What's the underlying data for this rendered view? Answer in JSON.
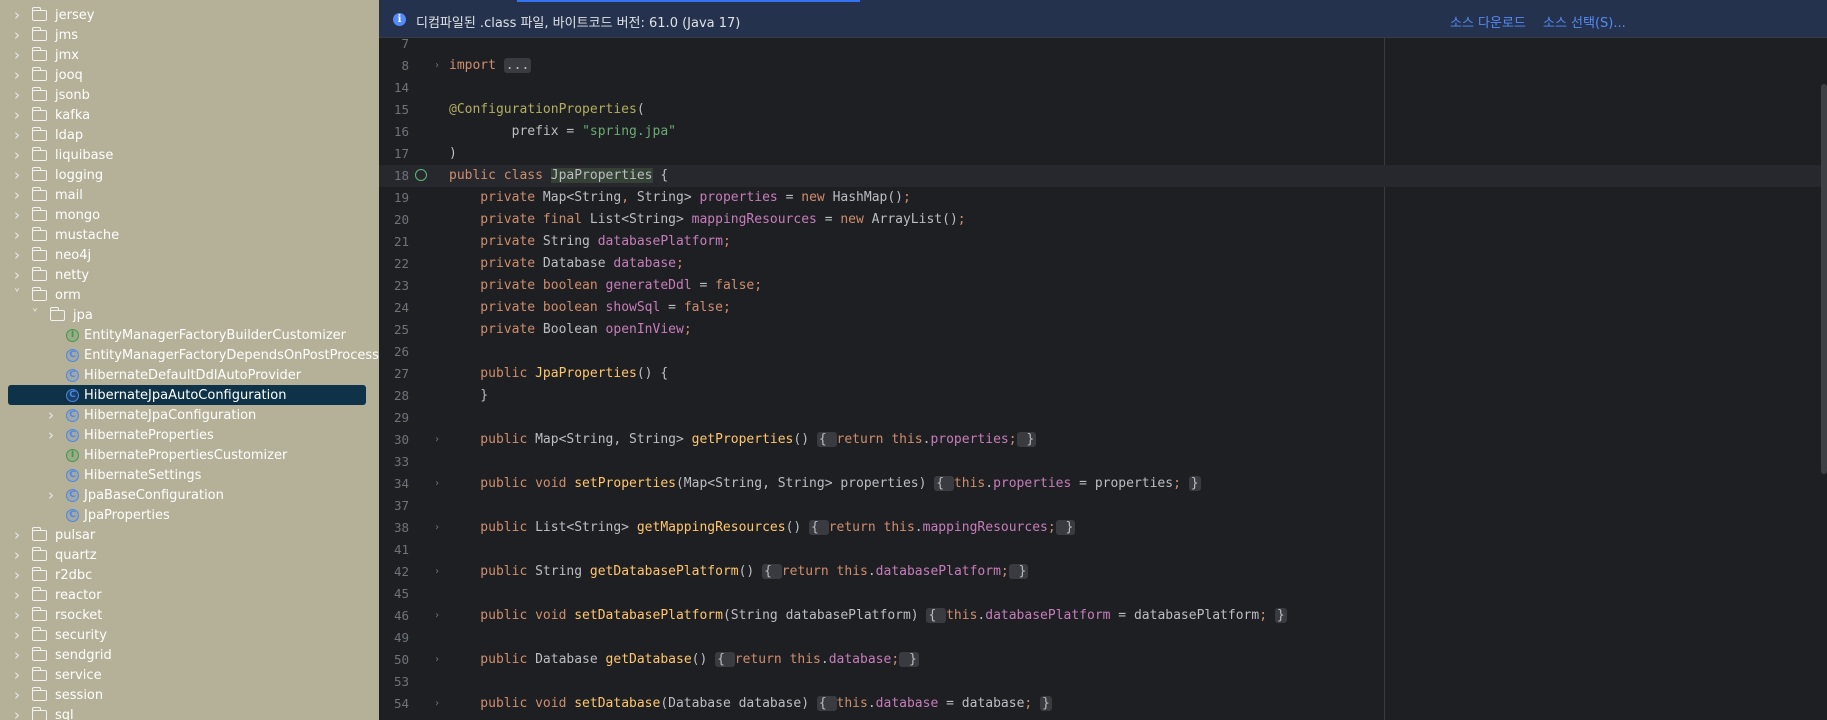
{
  "sidebar": {
    "items": [
      {
        "label": "jersey",
        "kind": "folder",
        "level": 0,
        "expanded": false
      },
      {
        "label": "jms",
        "kind": "folder",
        "level": 0,
        "expanded": false
      },
      {
        "label": "jmx",
        "kind": "folder",
        "level": 0,
        "expanded": false
      },
      {
        "label": "jooq",
        "kind": "folder",
        "level": 0,
        "expanded": false
      },
      {
        "label": "jsonb",
        "kind": "folder",
        "level": 0,
        "expanded": false
      },
      {
        "label": "kafka",
        "kind": "folder",
        "level": 0,
        "expanded": false
      },
      {
        "label": "ldap",
        "kind": "folder",
        "level": 0,
        "expanded": false
      },
      {
        "label": "liquibase",
        "kind": "folder",
        "level": 0,
        "expanded": false
      },
      {
        "label": "logging",
        "kind": "folder",
        "level": 0,
        "expanded": false
      },
      {
        "label": "mail",
        "kind": "folder",
        "level": 0,
        "expanded": false
      },
      {
        "label": "mongo",
        "kind": "folder",
        "level": 0,
        "expanded": false
      },
      {
        "label": "mustache",
        "kind": "folder",
        "level": 0,
        "expanded": false
      },
      {
        "label": "neo4j",
        "kind": "folder",
        "level": 0,
        "expanded": false
      },
      {
        "label": "netty",
        "kind": "folder",
        "level": 0,
        "expanded": false
      },
      {
        "label": "orm",
        "kind": "folder",
        "level": 0,
        "expanded": true
      },
      {
        "label": "jpa",
        "kind": "folder",
        "level": 1,
        "expanded": true
      },
      {
        "label": "EntityManagerFactoryBuilderCustomizer",
        "kind": "interface",
        "level": 2
      },
      {
        "label": "EntityManagerFactoryDependsOnPostProcessor",
        "kind": "class",
        "level": 2
      },
      {
        "label": "HibernateDefaultDdlAutoProvider",
        "kind": "class",
        "level": 2
      },
      {
        "label": "HibernateJpaAutoConfiguration",
        "kind": "class",
        "level": 2,
        "selected": true
      },
      {
        "label": "HibernateJpaConfiguration",
        "kind": "class",
        "level": 2,
        "expandable": true
      },
      {
        "label": "HibernateProperties",
        "kind": "class",
        "level": 2,
        "expandable": true
      },
      {
        "label": "HibernatePropertiesCustomizer",
        "kind": "interface",
        "level": 2
      },
      {
        "label": "HibernateSettings",
        "kind": "class",
        "level": 2
      },
      {
        "label": "JpaBaseConfiguration",
        "kind": "class",
        "level": 2,
        "expandable": true
      },
      {
        "label": "JpaProperties",
        "kind": "class",
        "level": 2
      },
      {
        "label": "pulsar",
        "kind": "folder",
        "level": 0,
        "expanded": false
      },
      {
        "label": "quartz",
        "kind": "folder",
        "level": 0,
        "expanded": false
      },
      {
        "label": "r2dbc",
        "kind": "folder",
        "level": 0,
        "expanded": false
      },
      {
        "label": "reactor",
        "kind": "folder",
        "level": 0,
        "expanded": false
      },
      {
        "label": "rsocket",
        "kind": "folder",
        "level": 0,
        "expanded": false
      },
      {
        "label": "security",
        "kind": "folder",
        "level": 0,
        "expanded": false
      },
      {
        "label": "sendgrid",
        "kind": "folder",
        "level": 0,
        "expanded": false
      },
      {
        "label": "service",
        "kind": "folder",
        "level": 0,
        "expanded": false
      },
      {
        "label": "session",
        "kind": "folder",
        "level": 0,
        "expanded": false
      },
      {
        "label": "sql",
        "kind": "folder",
        "level": 0,
        "expanded": false
      }
    ]
  },
  "banner": {
    "message": "디컴파일된 .class 파일, 바이트코드 버전: 61.0 (Java 17)",
    "download_sources": "소스 다운로드",
    "choose_sources": "소스 선택(S)...",
    "info_icon": "info-icon"
  },
  "editor": {
    "current_line": "18",
    "lines": [
      {
        "n": "7",
        "fold": "",
        "tokens": []
      },
      {
        "n": "8",
        "fold": "›",
        "tokens": [
          [
            "kw",
            "import "
          ],
          [
            "fbox",
            "..."
          ]
        ]
      },
      {
        "n": "14",
        "fold": "",
        "tokens": []
      },
      {
        "n": "15",
        "fold": "",
        "tokens": [
          [
            "ann",
            "@ConfigurationProperties"
          ],
          [
            "",
            "("
          ]
        ]
      },
      {
        "n": "16",
        "fold": "",
        "tokens": [
          [
            "",
            "        prefix = "
          ],
          [
            "str",
            "\"spring.jpa\""
          ]
        ]
      },
      {
        "n": "17",
        "fold": "",
        "tokens": [
          [
            "",
            ")"
          ]
        ]
      },
      {
        "n": "18",
        "fold": "",
        "tokens": [
          [
            "kw",
            "public class "
          ],
          [
            "cls-hl",
            "JpaProperties"
          ],
          [
            "",
            " {"
          ]
        ]
      },
      {
        "n": "19",
        "fold": "",
        "tokens": [
          [
            "kw",
            "    private "
          ],
          [
            "",
            "Map<String"
          ],
          [
            "kw",
            ", "
          ],
          [
            "",
            "String> "
          ],
          [
            "fld",
            "properties"
          ],
          [
            "",
            " = "
          ],
          [
            "kw",
            "new "
          ],
          [
            "",
            "HashMap()"
          ],
          [
            "kw",
            ";"
          ]
        ]
      },
      {
        "n": "20",
        "fold": "",
        "tokens": [
          [
            "kw",
            "    private final "
          ],
          [
            "",
            "List<String> "
          ],
          [
            "fld",
            "mappingResources"
          ],
          [
            "",
            " = "
          ],
          [
            "kw",
            "new "
          ],
          [
            "",
            "ArrayList()"
          ],
          [
            "kw",
            ";"
          ]
        ]
      },
      {
        "n": "21",
        "fold": "",
        "tokens": [
          [
            "kw",
            "    private "
          ],
          [
            "",
            "String "
          ],
          [
            "fld",
            "databasePlatform"
          ],
          [
            "kw",
            ";"
          ]
        ]
      },
      {
        "n": "22",
        "fold": "",
        "tokens": [
          [
            "kw",
            "    private "
          ],
          [
            "",
            "Database "
          ],
          [
            "fld",
            "database"
          ],
          [
            "kw",
            ";"
          ]
        ]
      },
      {
        "n": "23",
        "fold": "",
        "tokens": [
          [
            "kw",
            "    private boolean "
          ],
          [
            "fld",
            "generateDdl"
          ],
          [
            "",
            " = "
          ],
          [
            "kw",
            "false;"
          ]
        ]
      },
      {
        "n": "24",
        "fold": "",
        "tokens": [
          [
            "kw",
            "    private boolean "
          ],
          [
            "fld",
            "showSql"
          ],
          [
            "",
            " = "
          ],
          [
            "kw",
            "false;"
          ]
        ]
      },
      {
        "n": "25",
        "fold": "",
        "tokens": [
          [
            "kw",
            "    private "
          ],
          [
            "",
            "Boolean "
          ],
          [
            "fld",
            "openInView"
          ],
          [
            "kw",
            ";"
          ]
        ]
      },
      {
        "n": "26",
        "fold": "",
        "tokens": []
      },
      {
        "n": "27",
        "fold": "",
        "tokens": [
          [
            "kw",
            "    public "
          ],
          [
            "mname",
            "JpaProperties"
          ],
          [
            "",
            "() {"
          ]
        ]
      },
      {
        "n": "28",
        "fold": "",
        "tokens": [
          [
            "",
            "    }"
          ]
        ]
      },
      {
        "n": "29",
        "fold": "",
        "tokens": []
      },
      {
        "n": "30",
        "fold": "›",
        "tokens": [
          [
            "kw",
            "    public "
          ],
          [
            "",
            "Map<String, String> "
          ],
          [
            "mname",
            "getProperties"
          ],
          [
            "",
            "() "
          ],
          [
            "fbox",
            "{ "
          ],
          [
            "kw",
            "return this"
          ],
          [
            "",
            "."
          ],
          [
            "fld",
            "properties"
          ],
          [
            "kw",
            ";"
          ],
          [
            "fbox",
            " }"
          ]
        ]
      },
      {
        "n": "33",
        "fold": "",
        "tokens": []
      },
      {
        "n": "34",
        "fold": "›",
        "tokens": [
          [
            "kw",
            "    public void "
          ],
          [
            "mname",
            "setProperties"
          ],
          [
            "",
            "(Map<String, String> properties) "
          ],
          [
            "fbox",
            "{ "
          ],
          [
            "kw",
            "this"
          ],
          [
            "",
            "."
          ],
          [
            "fld",
            "properties"
          ],
          [
            "",
            " = properties"
          ],
          [
            "kw",
            "; "
          ],
          [
            "fbox",
            "}"
          ]
        ]
      },
      {
        "n": "37",
        "fold": "",
        "tokens": []
      },
      {
        "n": "38",
        "fold": "›",
        "tokens": [
          [
            "kw",
            "    public "
          ],
          [
            "",
            "List<String> "
          ],
          [
            "mname",
            "getMappingResources"
          ],
          [
            "",
            "() "
          ],
          [
            "fbox",
            "{ "
          ],
          [
            "kw",
            "return this"
          ],
          [
            "",
            "."
          ],
          [
            "fld",
            "mappingResources"
          ],
          [
            "kw",
            ";"
          ],
          [
            "fbox",
            " }"
          ]
        ]
      },
      {
        "n": "41",
        "fold": "",
        "tokens": []
      },
      {
        "n": "42",
        "fold": "›",
        "tokens": [
          [
            "kw",
            "    public "
          ],
          [
            "",
            "String "
          ],
          [
            "mname",
            "getDatabasePlatform"
          ],
          [
            "",
            "() "
          ],
          [
            "fbox",
            "{ "
          ],
          [
            "kw",
            "return this"
          ],
          [
            "",
            "."
          ],
          [
            "fld",
            "databasePlatform"
          ],
          [
            "kw",
            ";"
          ],
          [
            "fbox",
            " }"
          ]
        ]
      },
      {
        "n": "45",
        "fold": "",
        "tokens": []
      },
      {
        "n": "46",
        "fold": "›",
        "tokens": [
          [
            "kw",
            "    public void "
          ],
          [
            "mname",
            "setDatabasePlatform"
          ],
          [
            "",
            "(String databasePlatform) "
          ],
          [
            "fbox",
            "{ "
          ],
          [
            "kw",
            "this"
          ],
          [
            "",
            "."
          ],
          [
            "fld",
            "databasePlatform"
          ],
          [
            "",
            " = databasePlatform"
          ],
          [
            "kw",
            "; "
          ],
          [
            "fbox",
            "}"
          ]
        ]
      },
      {
        "n": "49",
        "fold": "",
        "tokens": []
      },
      {
        "n": "50",
        "fold": "›",
        "tokens": [
          [
            "kw",
            "    public "
          ],
          [
            "",
            "Database "
          ],
          [
            "mname",
            "getDatabase"
          ],
          [
            "",
            "() "
          ],
          [
            "fbox",
            "{ "
          ],
          [
            "kw",
            "return this"
          ],
          [
            "",
            "."
          ],
          [
            "fld",
            "database"
          ],
          [
            "kw",
            ";"
          ],
          [
            "fbox",
            " }"
          ]
        ]
      },
      {
        "n": "53",
        "fold": "",
        "tokens": []
      },
      {
        "n": "54",
        "fold": "›",
        "tokens": [
          [
            "kw",
            "    public void "
          ],
          [
            "mname",
            "setDatabase"
          ],
          [
            "",
            "(Database database) "
          ],
          [
            "fbox",
            "{ "
          ],
          [
            "kw",
            "this"
          ],
          [
            "",
            "."
          ],
          [
            "fld",
            "database"
          ],
          [
            "",
            " = database"
          ],
          [
            "kw",
            "; "
          ],
          [
            "fbox",
            "}"
          ]
        ]
      }
    ]
  },
  "icons": {
    "folder": "folder-icon",
    "class": "class-icon",
    "interface": "interface-icon",
    "chevron_right": "chevron-right-icon",
    "chevron_down": "chevron-down-icon",
    "implementation_marker": "implementation-icon"
  },
  "colors": {
    "sidebar_bg": "#b5b098",
    "selection": "#0e3348",
    "editor_bg": "#1e1f22",
    "banner_bg": "#25324d",
    "link": "#548af7",
    "keyword": "#cf8e6d",
    "field": "#c77dbb",
    "string": "#6aab73",
    "annotation": "#b3ae60",
    "method": "#ffc66d"
  }
}
